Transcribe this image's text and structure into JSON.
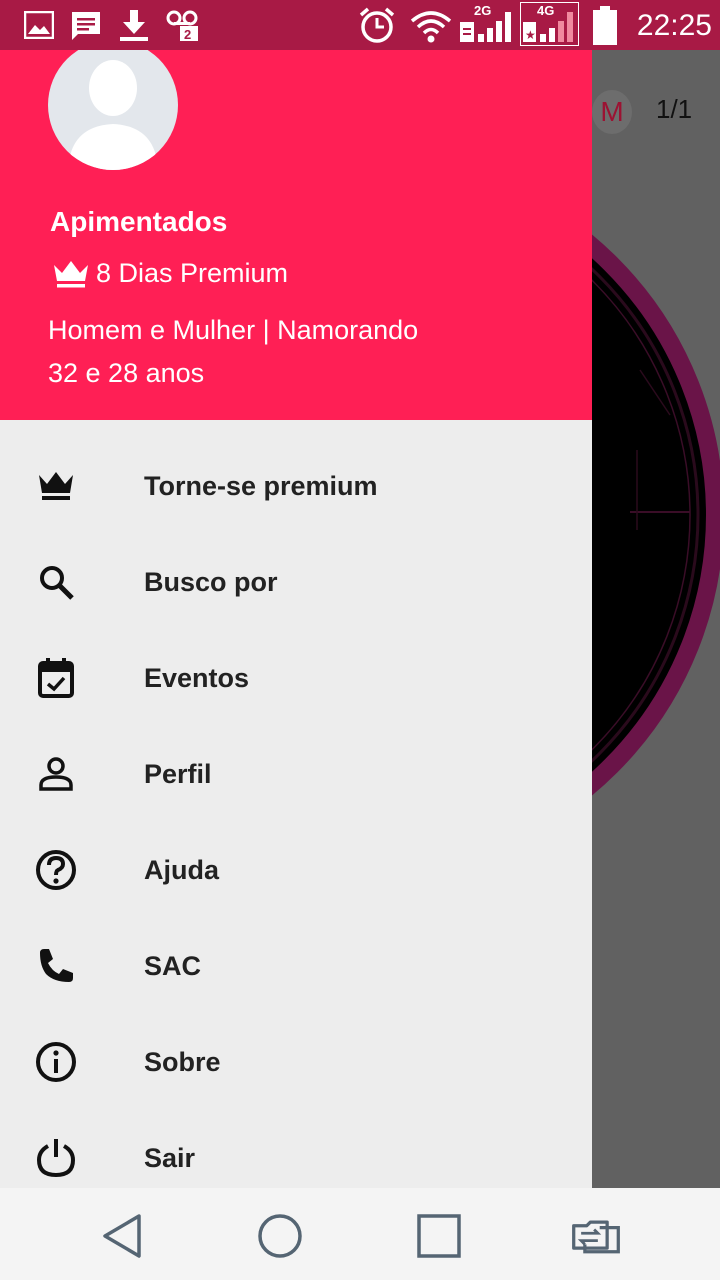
{
  "status_bar": {
    "time": "22:25",
    "network_1": "2G",
    "network_2": "4G",
    "icons": [
      "gallery-icon",
      "message-icon",
      "download-icon",
      "voicemail-icon",
      "alarm-icon",
      "wifi-icon",
      "signal-icon",
      "battery-icon"
    ]
  },
  "background": {
    "avatar_letter": "M",
    "page_count": "1/1"
  },
  "drawer": {
    "header": {
      "name": "Apimentados",
      "premium": "8 Dias Premium",
      "description": "Homem e Mulher | Namorando",
      "ages": "32 e 28 anos",
      "background_color": "#ff1f55"
    },
    "menu": [
      {
        "label": "Torne-se premium",
        "icon": "crown-icon"
      },
      {
        "label": "Busco por",
        "icon": "search-icon"
      },
      {
        "label": "Eventos",
        "icon": "calendar-check-icon"
      },
      {
        "label": "Perfil",
        "icon": "person-icon"
      },
      {
        "label": "Ajuda",
        "icon": "help-icon"
      },
      {
        "label": "SAC",
        "icon": "phone-icon"
      },
      {
        "label": "Sobre",
        "icon": "info-icon"
      },
      {
        "label": "Sair",
        "icon": "power-icon"
      }
    ]
  },
  "nav_bar": {
    "buttons": [
      "back-icon",
      "home-icon",
      "recents-icon",
      "switch-sim-icon"
    ]
  }
}
